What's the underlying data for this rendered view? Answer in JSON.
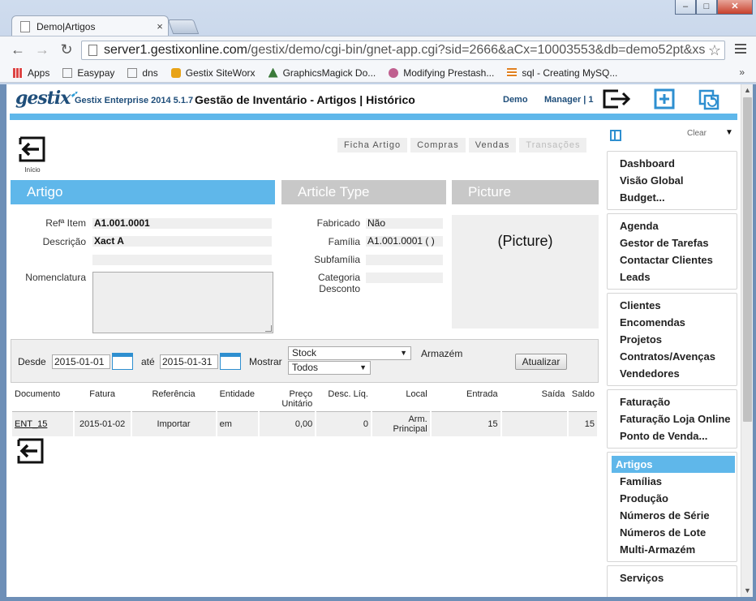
{
  "browser": {
    "tab_title": "Demo|Artigos",
    "tab_close": "×",
    "url_host": "server1.gestixonline.com",
    "url_path": "/gestix/demo/cgi-bin/gnet-app.cgi?sid=2666&aCx=10003553&db=demo52pt&xss",
    "star": "☆",
    "back": "←",
    "forward": "→",
    "reload": "↻",
    "win_minimize": "–",
    "win_maximize": "□",
    "win_close": "✕",
    "bookmarks": [
      {
        "label": "Apps",
        "icon": "apps-grid-icon",
        "color": "#d44"
      },
      {
        "label": "Easypay",
        "icon": "page-icon",
        "color": "#888"
      },
      {
        "label": "dns",
        "icon": "page-icon",
        "color": "#888"
      },
      {
        "label": "Gestix SiteWorx",
        "icon": "folder-icon",
        "color": "#e8a317"
      },
      {
        "label": "GraphicsMagick Do...",
        "icon": "wizard-icon",
        "color": "#3a7a3a"
      },
      {
        "label": "Modifying Prestash...",
        "icon": "puzzle-icon",
        "color": "#c06090"
      },
      {
        "label": "sql - Creating MySQ...",
        "icon": "stack-icon",
        "color": "#e08020"
      }
    ],
    "bookmarks_more": "»"
  },
  "header": {
    "logo": "gestix",
    "app_name": "Gestix Enterprise 2014 5.1.7",
    "title": "Gestão de Inventário - Artigos | Histórico",
    "user": "Demo",
    "role": "Manager | 1"
  },
  "home": {
    "label": "Início"
  },
  "subtabs": [
    {
      "label": "Ficha Artigo",
      "disabled": false
    },
    {
      "label": "Compras",
      "disabled": false
    },
    {
      "label": "Vendas",
      "disabled": false
    },
    {
      "label": "Transações",
      "disabled": true
    }
  ],
  "sections": {
    "artigo": "Artigo",
    "type": "Article Type",
    "picture": "Picture"
  },
  "artigo": {
    "ref_label": "Refª Item",
    "ref_value": "A1.001.0001",
    "desc_label": "Descrição",
    "desc_value": "Xact A",
    "nomenclatura_label": "Nomenclatura"
  },
  "article_type": {
    "fabricado_label": "Fabricado",
    "fabricado_value": "Não",
    "familia_label": "Família",
    "familia_value": "A1.001.0001 ( )",
    "subfamilia_label": "Subfamília",
    "categoria_label_1": "Categoria",
    "categoria_label_2": "Desconto"
  },
  "picture": {
    "placeholder": "(Picture)"
  },
  "filters": {
    "desde_label": "Desde",
    "desde_value": "2015-01-01",
    "ate_label": "até",
    "ate_value": "2015-01-31",
    "mostrar_label": "Mostrar",
    "mostrar_value": "Stock",
    "armazem_label": "Armazém",
    "tipo_value": "Todos",
    "submit": "Atualizar"
  },
  "table": {
    "columns": [
      "Documento",
      "Fatura",
      "Referência",
      "Entidade",
      "Preço Unitário",
      "Desc. Líq.",
      "Local",
      "Entrada",
      "Saída",
      "Saldo"
    ],
    "rows": [
      [
        "ENT_15",
        "2015-01-02",
        "Importar",
        "em",
        "0,00",
        "0",
        "Arm. Principal",
        "15",
        "",
        "15"
      ]
    ]
  },
  "sidebar": {
    "clear": "Clear",
    "caret": "▼",
    "groups": [
      [
        "Dashboard",
        "Visão Global",
        "Budget..."
      ],
      [
        "Agenda",
        "Gestor de Tarefas",
        "Contactar Clientes",
        "Leads"
      ],
      [
        "Clientes",
        "Encomendas",
        "Projetos",
        "Contratos/Avenças",
        "Vendedores"
      ],
      [
        "Faturação",
        "Faturação Loja Online",
        "Ponto de Venda..."
      ],
      [
        "Artigos",
        "Famílias",
        "Produção",
        "Números de Série",
        "Números de Lote",
        "Multi-Armazém"
      ],
      [
        "Serviços"
      ]
    ],
    "active": "Artigos"
  },
  "colors": {
    "accent": "#5fb7ea",
    "brand": "#1f4e7a",
    "icon_blue": "#2e8fd0"
  }
}
